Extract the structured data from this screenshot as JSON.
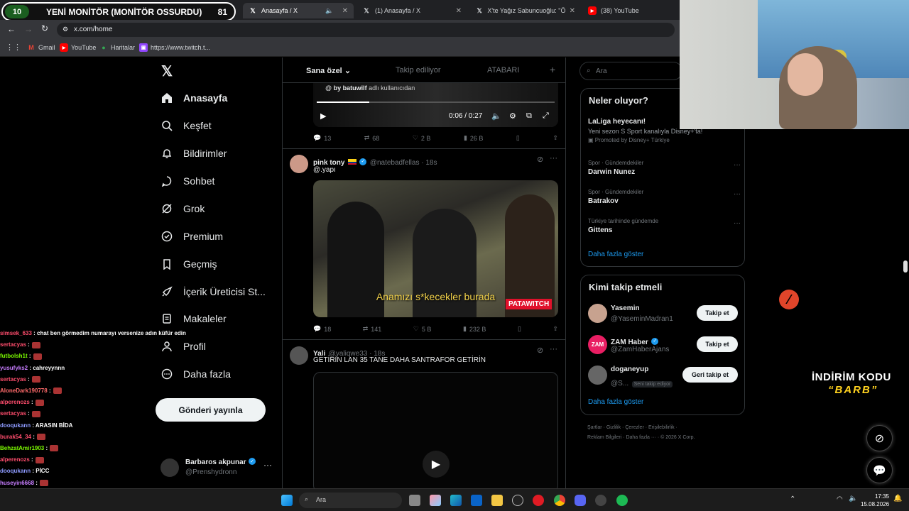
{
  "browser": {
    "tabs": [
      {
        "label": "Anasayfa / X",
        "icon": "x-icon"
      },
      {
        "label": "(1) Anasayfa / X",
        "icon": "x-icon"
      },
      {
        "label": "X'te Yağız Sabuncuoğlu: \"ÖZEL",
        "icon": "x-icon"
      },
      {
        "label": "(38) YouTube",
        "icon": "youtube-icon"
      }
    ],
    "url": "x.com/home",
    "bookmarks": [
      {
        "label": "Gmail",
        "icon": "gmail-icon"
      },
      {
        "label": "YouTube",
        "icon": "youtube-icon"
      },
      {
        "label": "Haritalar",
        "icon": "maps-icon"
      },
      {
        "label": "https://www.twitch.t...",
        "icon": "twitch-icon"
      }
    ]
  },
  "overlay": {
    "number": "10",
    "title": "YENİ MONİTÖR (MONİTÖR OSSURDU)",
    "count": "81"
  },
  "nav": {
    "items": [
      {
        "label": "Anasayfa",
        "icon": "home-icon"
      },
      {
        "label": "Keşfet",
        "icon": "search-icon"
      },
      {
        "label": "Bildirimler",
        "icon": "bell-icon"
      },
      {
        "label": "Sohbet",
        "icon": "chat-icon"
      },
      {
        "label": "Grok",
        "icon": "grok-icon"
      },
      {
        "label": "Premium",
        "icon": "premium-icon"
      },
      {
        "label": "Geçmiş",
        "icon": "bookmark-icon"
      },
      {
        "label": "İçerik Üreticisi St...",
        "icon": "rocket-icon"
      },
      {
        "label": "Makaleler",
        "icon": "article-icon"
      },
      {
        "label": "Profil",
        "icon": "profile-icon"
      },
      {
        "label": "Daha fazla",
        "icon": "more-icon"
      }
    ],
    "post_button": "Gönderi yayınla",
    "account_name": "Barbaros akpunar",
    "account_handle": "@Prenshydronn"
  },
  "feed": {
    "tabs": [
      "Sana özel",
      "Takip ediliyor",
      "ATABARI"
    ],
    "tweet0": {
      "byline_user": "by batuwilf",
      "byline_suffix": "adlı kullanıcıdan",
      "time": "0:06 / 0:27",
      "progress": 0.22,
      "replies": "13",
      "retweets": "68",
      "likes": "2 B",
      "views": "26 B"
    },
    "tweet1": {
      "name": "pink tony",
      "handle": "@natebadfellas · 18s",
      "text": "@.yapı",
      "subtitle": "Anamızı s*kecekler burada",
      "watermark": "PATAWITCH",
      "replies": "18",
      "retweets": "141",
      "likes": "5 B",
      "views": "232 B"
    },
    "tweet2": {
      "name": "Yali",
      "handle": "@yaliqwe33 · 18s",
      "text": "GETİRİN LAN 35 TANE DAHA SANTRAFOR GETİRİN"
    }
  },
  "sidebar": {
    "search_placeholder": "Ara",
    "trends_title": "Neler oluyor?",
    "promo_title": "LaLiga heyecanı!",
    "promo_text": "Yeni sezon S Sport kanalıyla Disney+'ta!",
    "promo_by": "Promoted by Disney+ Türkiye",
    "trends": [
      {
        "context": "Spor · Gündemdekiler",
        "title": "Darwin Nunez"
      },
      {
        "context": "Spor · Gündemdekiler",
        "title": "Batrakov"
      },
      {
        "context": "Türkiye tarihinde gündemde",
        "title": "Gittens"
      }
    ],
    "show_more": "Daha fazla göster",
    "follow_title": "Kimi takip etmeli",
    "follow": [
      {
        "name": "Yasemin",
        "handle": "@YaseminMadran1",
        "button": "Takip et"
      },
      {
        "name": "ZAM Haber",
        "handle": "@ZamHaberAjans",
        "button": "Takip et"
      },
      {
        "name": "doganeyup",
        "handle": "@S...",
        "badge": "Seni takip ediyor",
        "button": "Geri takip et"
      }
    ],
    "follow_more": "Daha fazla göster",
    "footer1": [
      "Şartlar",
      "Gizlilik",
      "Çerezler",
      "Erişilebilirlik"
    ],
    "footer2": [
      "Reklam Bilgileri",
      "Daha fazla ···",
      "© 2026 X Corp."
    ]
  },
  "chat": [
    {
      "user": "simsek_633",
      "text": ": chat ben görmedim numarayı versenize adın küfür edin",
      "color": "#ff4d6d"
    },
    {
      "user": "sertacyas",
      "text": ":",
      "color": "#ff4d6d",
      "emote": true
    },
    {
      "user": "futbolsh1t",
      "text": ":",
      "color": "#7cfc00",
      "emote": true
    },
    {
      "user": "yusufyks2",
      "text": ": cahreyynnn",
      "color": "#c77dff"
    },
    {
      "user": "sertacyas",
      "text": ":",
      "color": "#ff4d6d",
      "emote": true
    },
    {
      "user": "AloneDark190778",
      "text": ":",
      "color": "#ff6b6b",
      "emote": true
    },
    {
      "user": "alperenozs",
      "text": ":",
      "color": "#ff4d6d",
      "emote": true
    },
    {
      "user": "sertacyas",
      "text": ":",
      "color": "#ff4d6d",
      "emote": true
    },
    {
      "user": "dooqukann",
      "text": ": ARASIN BİDA",
      "color": "#8e9bff"
    },
    {
      "user": "burak54_34",
      "text": ":",
      "color": "#ff4d6d",
      "emote": true
    },
    {
      "user": "BehzatAmir1903",
      "text": ":",
      "color": "#7cfc00",
      "emote": true
    },
    {
      "user": "alperenozs",
      "text": ":",
      "color": "#ff4d6d",
      "emote": true
    },
    {
      "user": "dooqukann",
      "text": ": PİCC",
      "color": "#8e9bff"
    },
    {
      "user": "huseyin6668",
      "text": ":",
      "color": "#c77dff",
      "emote": true
    },
    {
      "user": "BehzatAmir1903",
      "text": ":",
      "color": "#7cfc00",
      "emote": true
    }
  ],
  "taskbar": {
    "search": "Ara",
    "time": "17:35",
    "date": "15.08.2026"
  },
  "promo": {
    "line1": "İNDİRİM KODU",
    "line2": "“BARB”"
  }
}
